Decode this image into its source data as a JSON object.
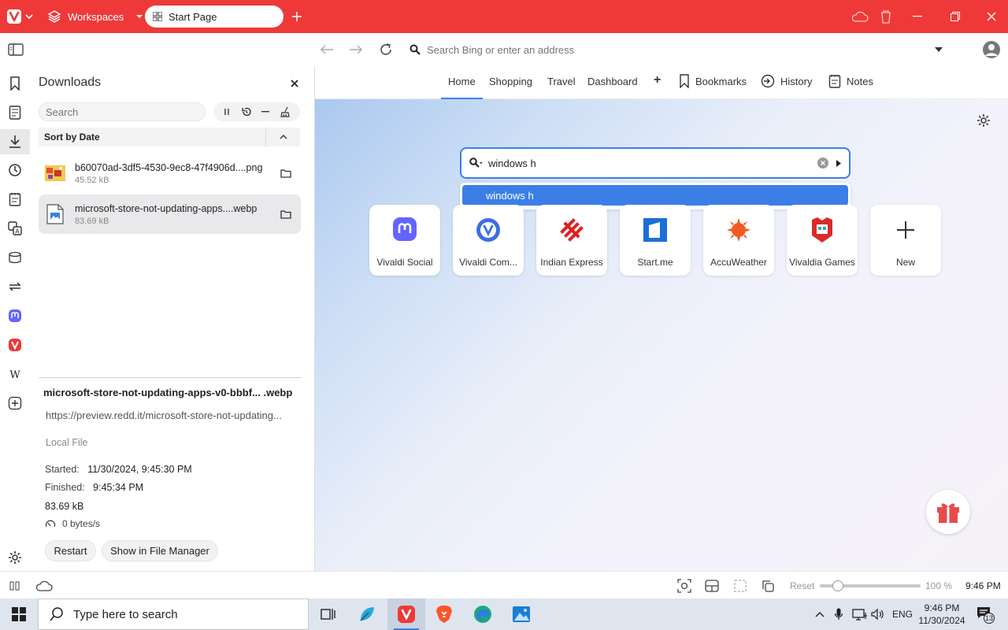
{
  "titlebar": {
    "workspaces_label": "Workspaces",
    "tab_title": "Start Page",
    "brand_color": "#ef3939"
  },
  "addressbar": {
    "placeholder": "Search Bing or enter an address"
  },
  "downloads_panel": {
    "title": "Downloads",
    "search_placeholder": "Search",
    "sort_label": "Sort by Date",
    "items": [
      {
        "name": "b60070ad-3df5-4530-9ec8-47f4906d....png",
        "size": "45.52 kB"
      },
      {
        "name": "microsoft-store-not-updating-apps....webp",
        "size": "83.69 kB"
      }
    ],
    "detail": {
      "filename": "microsoft-store-not-updating-apps-v0-bbbf... .webp",
      "url": "https://preview.redd.it/microsoft-store-not-updating...",
      "local_file": "Local File",
      "started_label": "Started:",
      "started_value": "11/30/2024, 9:45:30 PM",
      "finished_label": "Finished:",
      "finished_value": "9:45:34 PM",
      "size": "83.69 kB",
      "speed": "0 bytes/s",
      "restart_label": "Restart",
      "show_label": "Show in File Manager"
    }
  },
  "main_toolbar": {
    "tabs": [
      "Home",
      "Shopping",
      "Travel",
      "Dashboard"
    ],
    "add_label": "+",
    "bookmarks_label": "Bookmarks",
    "history_label": "History",
    "notes_label": "Notes"
  },
  "startpage": {
    "search_query": "windows h",
    "suggestion": "windows h",
    "speed_dials": [
      {
        "label": "Vivaldi Social",
        "icon": "mastodon-icon"
      },
      {
        "label": "Vivaldi Com...",
        "icon": "vivaldi-icon"
      },
      {
        "label": "Indian Express",
        "icon": "indian-express-icon"
      },
      {
        "label": "Start.me",
        "icon": "startme-icon"
      },
      {
        "label": "AccuWeather",
        "icon": "accuweather-icon"
      },
      {
        "label": "Vivaldia Games",
        "icon": "vivaldia-games-icon"
      },
      {
        "label": "New",
        "icon": "plus-icon"
      }
    ]
  },
  "statusbar": {
    "reset_label": "Reset",
    "zoom": "100 %",
    "zoom_fraction": 0.18,
    "time": "9:46 PM"
  },
  "taskbar": {
    "search_placeholder": "Type here to search",
    "language": "ENG",
    "clock_time": "9:46 PM",
    "clock_date": "11/30/2024",
    "notification_count": "13"
  }
}
